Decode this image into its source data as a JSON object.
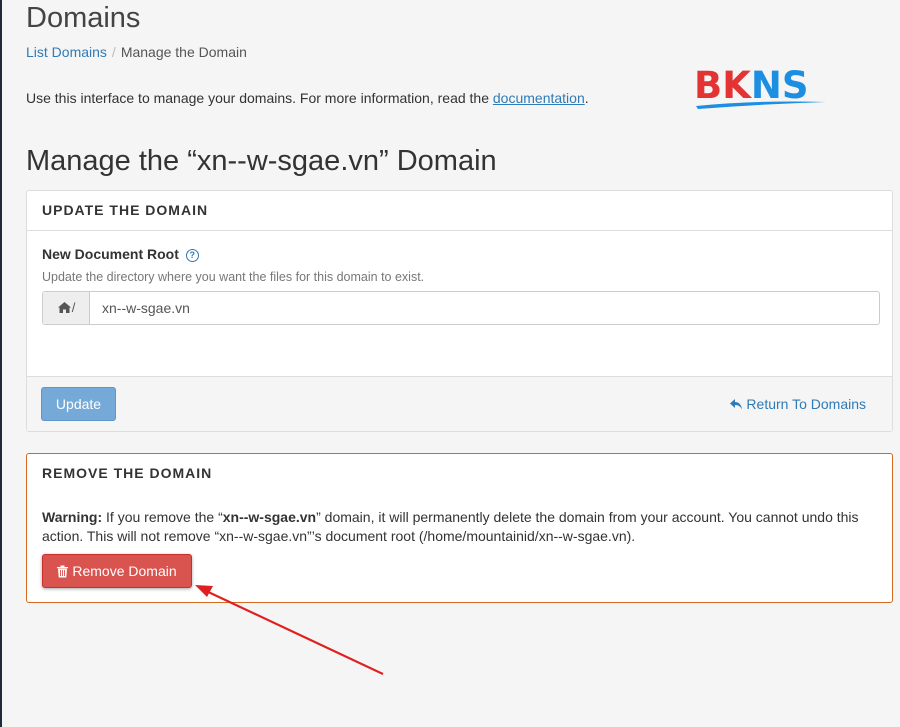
{
  "header": {
    "title": "Domains",
    "breadcrumb": {
      "parent": "List Domains",
      "separator": "/",
      "current": "Manage the Domain"
    },
    "intro_text": "Use this interface to manage your domains. For more information, read the ",
    "intro_link": "documentation",
    "intro_end": "."
  },
  "logo": {
    "text_red": "BK",
    "text_blue": "NS"
  },
  "manage_title": "Manage the “xn--w-sgae.vn” Domain",
  "update_panel": {
    "heading": "UPDATE THE DOMAIN",
    "field_label": "New Document Root",
    "help_icon": "?",
    "field_help": "Update the directory where you want the files for this domain to exist.",
    "addon_text": "/",
    "docroot_value": "xn--w-sgae.vn",
    "update_label": "Update",
    "return_label": "Return To Domains"
  },
  "remove_panel": {
    "heading": "REMOVE THE DOMAIN",
    "warning_label": "Warning:",
    "warning_a": " If you remove the “",
    "warning_domain": "xn--w-sgae.vn",
    "warning_b": "” domain, it will permanently delete the domain from your account. You cannot undo this action. This will not remove “xn--w-sgae.vn”’s document root (/home/mountainid/xn--w-sgae.vn).",
    "remove_label": "Remove Domain"
  },
  "colors": {
    "link": "#2e7bb8",
    "primary_button": "#74a9d8",
    "danger_button": "#d9534f",
    "remove_border": "#d2691e",
    "annotation_arrow": "#e02020"
  },
  "icons": {
    "home": "home-icon",
    "help": "question-circle-icon",
    "return": "reply-arrow-icon",
    "trash": "trash-icon"
  }
}
